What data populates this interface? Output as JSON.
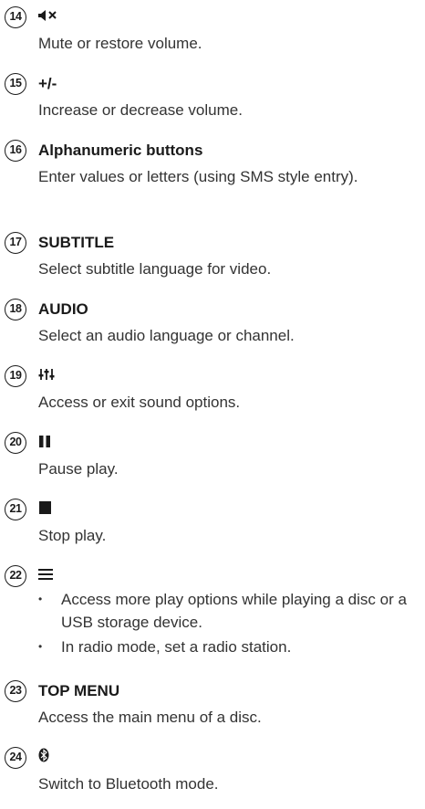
{
  "items": [
    {
      "number": "14",
      "icon": "mute-icon",
      "description": "Mute or restore volume."
    },
    {
      "number": "15",
      "heading": "+/-",
      "description": "Increase or decrease volume."
    },
    {
      "number": "16",
      "heading": "Alphanumeric buttons",
      "description": "Enter values or letters (using SMS style entry)."
    },
    {
      "number": "17",
      "heading": "SUBTITLE",
      "description": "Select subtitle language for video."
    },
    {
      "number": "18",
      "heading": "AUDIO",
      "description": "Select an audio language or channel."
    },
    {
      "number": "19",
      "icon": "sound-options-icon",
      "description": "Access or exit sound options."
    },
    {
      "number": "20",
      "icon": "pause-icon",
      "description": "Pause play."
    },
    {
      "number": "21",
      "icon": "stop-icon",
      "description": "Stop play."
    },
    {
      "number": "22",
      "icon": "options-menu-icon",
      "bullets": [
        "Access more play options while playing a disc or a USB storage device.",
        "In radio mode, set a radio station."
      ]
    },
    {
      "number": "23",
      "heading": "TOP MENU",
      "description": "Access the main menu of a disc."
    },
    {
      "number": "24",
      "icon": "bluetooth-icon",
      "description": "Switch to Bluetooth mode."
    }
  ]
}
